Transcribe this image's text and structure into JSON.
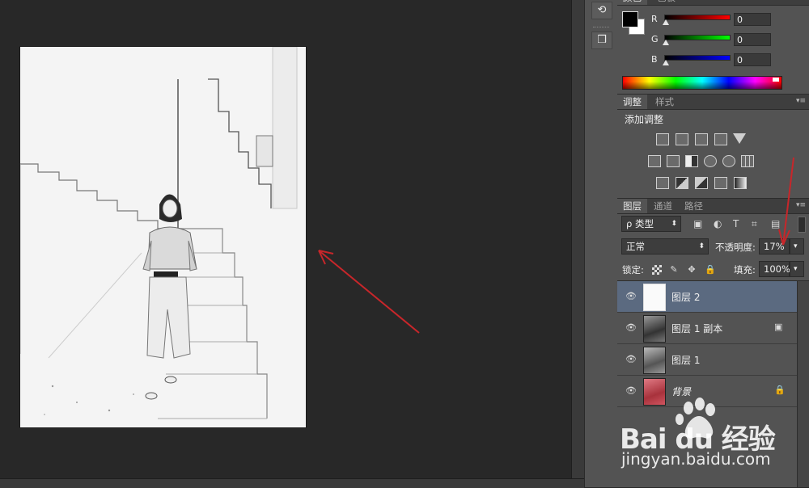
{
  "colors": {
    "panel_bg": "#535353",
    "workspace_bg": "#282828",
    "selected_layer": "#5b6a80",
    "annotation_arrow": "#c8262a"
  },
  "color_panel": {
    "tabs": [
      "颜色",
      "色板"
    ],
    "channels": [
      {
        "label": "R",
        "value": "0",
        "gradient_end": "#ff0000"
      },
      {
        "label": "G",
        "value": "0",
        "gradient_end": "#00ff00"
      },
      {
        "label": "B",
        "value": "0",
        "gradient_end": "#0000ff"
      }
    ]
  },
  "adjustments_panel": {
    "tabs": [
      "调整",
      "样式"
    ],
    "title": "添加调整",
    "icon_rows": [
      [
        "brightness-icon",
        "levels-icon",
        "curves-icon",
        "exposure-icon",
        "vibrance-icon"
      ],
      [
        "hue-saturation-icon",
        "color-balance-icon",
        "black-white-icon",
        "photo-filter-icon",
        "channel-mixer-icon",
        "color-lookup-icon"
      ],
      [
        "invert-icon",
        "posterize-icon",
        "threshold-icon",
        "selective-color-icon",
        "gradient-map-icon"
      ]
    ]
  },
  "layers_panel": {
    "tabs": [
      "图层",
      "通道",
      "路径"
    ],
    "filter_label": "ρ 类型",
    "blend_mode": "正常",
    "opacity_label": "不透明度:",
    "opacity_value": "17%",
    "lock_label": "锁定:",
    "fill_label": "填充:",
    "fill_value": "100%",
    "layers": [
      {
        "name": "图层 2",
        "selected": true,
        "badge": ""
      },
      {
        "name": "图层 1 副本",
        "selected": false,
        "badge": "▣"
      },
      {
        "name": "图层 1",
        "selected": false,
        "badge": ""
      },
      {
        "name": "背景",
        "selected": false,
        "badge": "🔒"
      }
    ]
  },
  "watermark": {
    "logo_text": "Bai du 经验",
    "url_text": "jingyan.baidu.com"
  }
}
